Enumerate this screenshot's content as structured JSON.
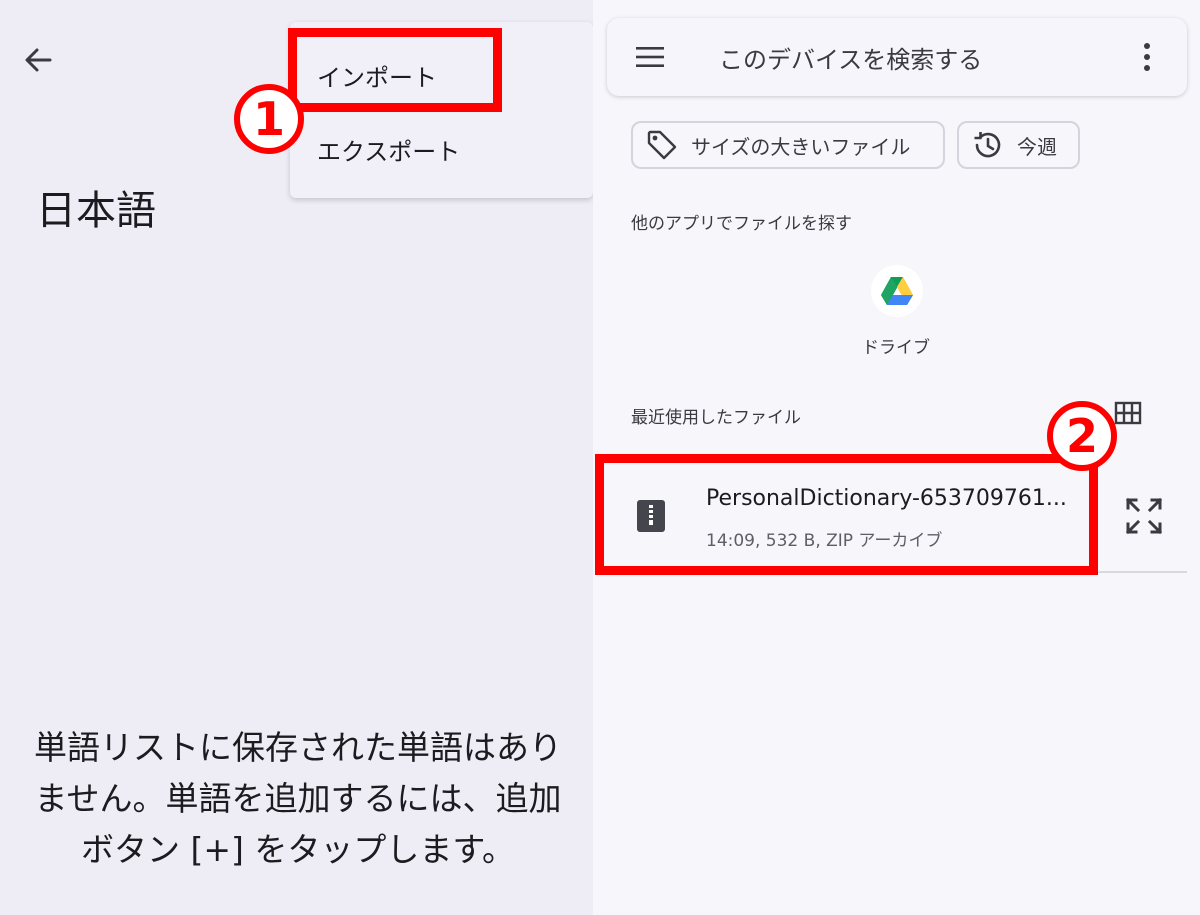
{
  "left": {
    "page_title": "日本語",
    "menu": {
      "import_label": "インポート",
      "export_label": "エクスポート"
    },
    "empty_message_lines": [
      "単語リストに保存された単語はあり",
      "ません。単語を追加するには、追加",
      "ボタン [+] をタップします。"
    ]
  },
  "annotations": {
    "step1": "1",
    "step2": "2",
    "color": "#ff0000"
  },
  "right": {
    "search_placeholder": "このデバイスを検索する",
    "chips": [
      {
        "label": "サイズの大きいファイル",
        "icon": "tag-icon"
      },
      {
        "label": "今週",
        "icon": "history-icon"
      }
    ],
    "other_apps_label": "他のアプリでファイルを探す",
    "apps": [
      {
        "label": "ドライブ",
        "icon": "google-drive-icon"
      }
    ],
    "recent_label": "最近使用したファイル",
    "files": [
      {
        "name": "PersonalDictionary-653709761...",
        "meta": "14:09, 532 B, ZIP アーカイブ",
        "icon": "zip-file-icon"
      }
    ]
  },
  "colors": {
    "background": "#eeedf6",
    "annotation_red": "#ff0000"
  }
}
